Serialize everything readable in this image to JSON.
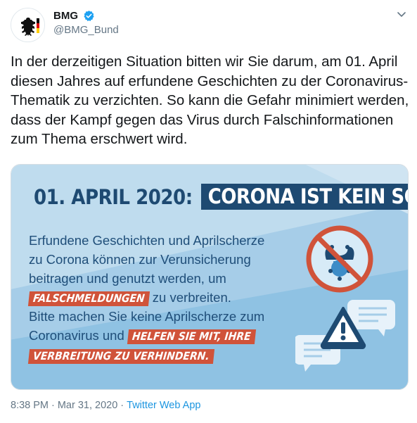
{
  "author": {
    "name": "BMG",
    "handle": "@BMG_Bund",
    "verified": true
  },
  "tweet": {
    "text": "In der derzeitigen Situation bitten wir Sie darum, am 01. April diesen Jahres auf erfundene Geschichten zu der Coronavirus-Thematik zu verzichten. So kann die Gefahr minimiert werden, dass der Kampf gegen das Virus durch Falschinformationen zum Thema erschwert wird."
  },
  "media": {
    "title_date": "01. APRIL 2020:",
    "title_highlight": "CORONA IST KEIN SCHERZ",
    "lines": [
      "Erfundene Geschichten und Aprilscherze",
      "zu Corona können zur Verunsicherung",
      "beitragen und genutzt werden, um"
    ],
    "tag1": "FALSCHMELDUNGEN",
    "after_tag1": " zu verbreiten.",
    "line5": "Bitte machen Sie keine Aprilscherze zum",
    "line6_start": "Coronavirus und ",
    "tag2": "HELFEN SIE MIT, IHRE",
    "tag3": "VERBREITUNG ZU VERHINDERN.",
    "colors": {
      "background_light": "#bfdcee",
      "background_mid": "#8fc2e3",
      "title_dark": "#1e4a72",
      "text_blue": "#1f4e79",
      "tag_red": "#d0533a"
    },
    "icons": [
      "no-jester-icon",
      "chat-bubbles-icon",
      "warning-triangle-icon"
    ]
  },
  "footer": {
    "time": "8:38 PM",
    "date": "Mar 31, 2020",
    "source": "Twitter Web App"
  }
}
